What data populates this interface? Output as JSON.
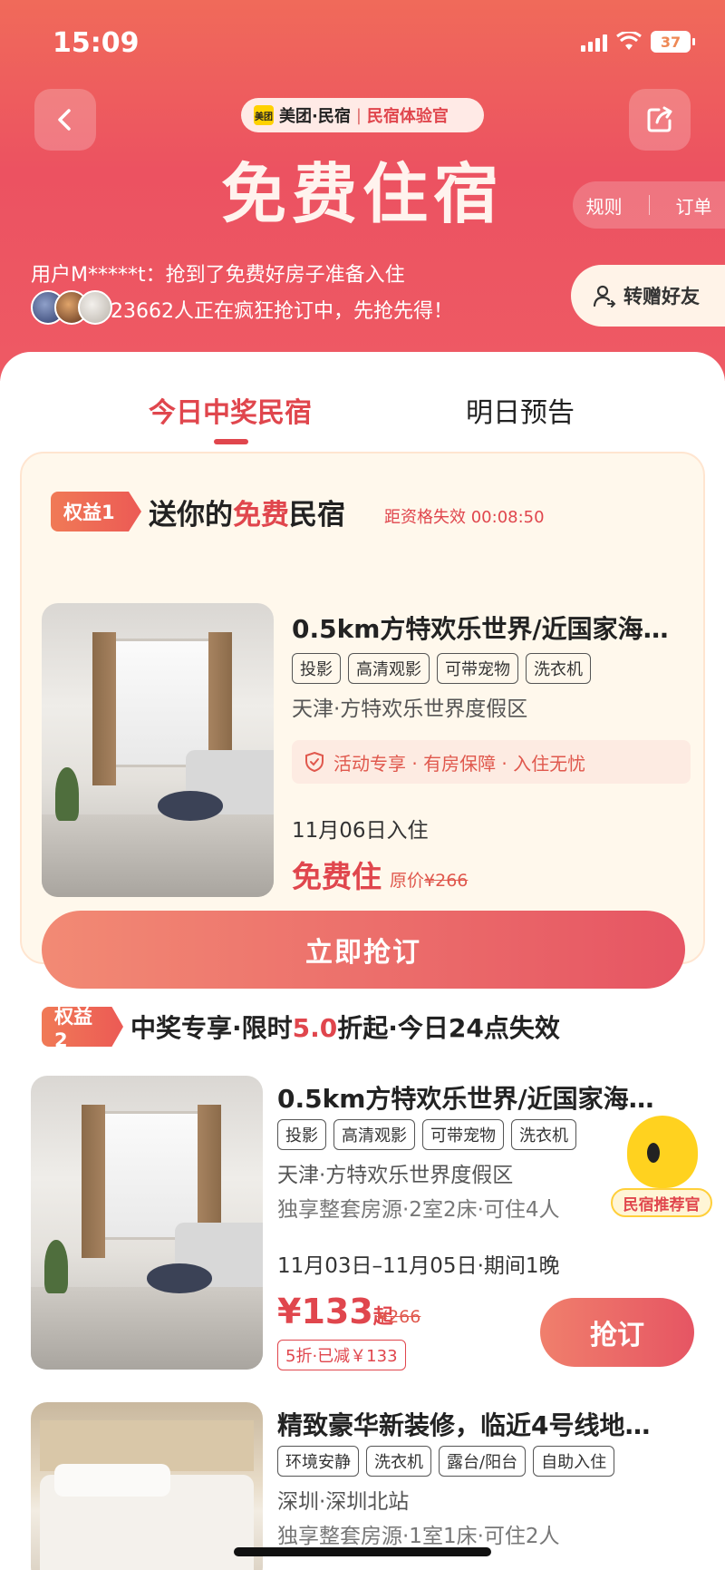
{
  "status_bar": {
    "time": "15:09",
    "battery": "37"
  },
  "header": {
    "brand_logo": "美团",
    "brand_name": "美团·民宿",
    "brand_sep": "|",
    "brand_sub": "民宿体验官",
    "title": "免费住宿",
    "rules_label": "规则",
    "orders_label": "订单",
    "ticker": "用户M*****t：抢到了免费好房子准备入住",
    "count_text": "23662人正在疯狂抢订中，先抢先得！",
    "gift_label": "转赠好友"
  },
  "tabs": [
    {
      "label": "今日中奖民宿",
      "active": true
    },
    {
      "label": "明日预告",
      "active": false
    }
  ],
  "benefit1": {
    "badge": "权益1",
    "title_pre": "送你的",
    "title_hl": "免费",
    "title_post": "民宿",
    "countdown_label": "距资格失效 00:08:50",
    "listing": {
      "title": "0.5km方特欢乐世界/近国家海…",
      "tags": [
        "投影",
        "高清观影",
        "可带宠物",
        "洗衣机"
      ],
      "location": "天津·方特欢乐世界度假区",
      "guarantee": "活动专享 · 有房保障 · 入住无忧",
      "checkin": "11月06日入住",
      "free_label": "免费住",
      "orig_label": "原价",
      "orig_price": "¥266"
    },
    "button": "立即抢订"
  },
  "benefit2": {
    "badge": "权益2",
    "title_pre": "中奖专享·限时",
    "title_hl": "5.0",
    "title_post": "折起·今日24点失效",
    "listings": [
      {
        "title": "0.5km方特欢乐世界/近国家海…",
        "tags": [
          "投影",
          "高清观影",
          "可带宠物",
          "洗衣机"
        ],
        "location": "天津·方特欢乐世界度假区",
        "detail": "独享整套房源·2室2床·可住4人",
        "dates": "11月03日–11月05日·期间1晚",
        "price": "¥133",
        "price_suffix": "起",
        "orig_price": "¥266",
        "discount": "5折·已减￥133",
        "button": "抢订"
      },
      {
        "title": "精致豪华新装修，临近4号线地…",
        "tags": [
          "环境安静",
          "洗衣机",
          "露台/阳台",
          "自助入住"
        ],
        "location": "深圳·深圳北站",
        "detail": "独享整套房源·1室1床·可住2人"
      }
    ]
  },
  "mascot_label": "民宿推荐官",
  "colors": {
    "accent": "#e0464d",
    "header_top": "#f06a5a",
    "card_bg": "#fff8ec"
  }
}
